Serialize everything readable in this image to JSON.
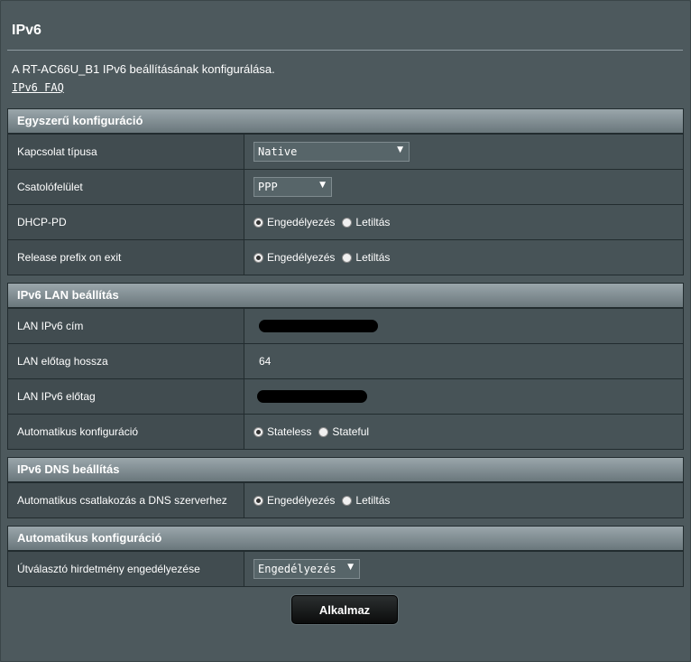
{
  "page": {
    "title": "IPv6",
    "description": "A RT-AC66U_B1 IPv6 beállításának konfigurálása.",
    "faq_link": "IPv6 FAQ"
  },
  "sections": {
    "basic": {
      "header": "Egyszerű konfiguráció",
      "connection_type": {
        "label": "Kapcsolat típusa",
        "value": "Native"
      },
      "interface": {
        "label": "Csatolófelület",
        "value": "PPP"
      },
      "dhcp_pd": {
        "label": "DHCP-PD",
        "opt_on": "Engedélyezés",
        "opt_off": "Letiltás",
        "selected": "Engedélyezés"
      },
      "release_prefix": {
        "label": "Release prefix on exit",
        "opt_on": "Engedélyezés",
        "opt_off": "Letiltás",
        "selected": "Engedélyezés"
      }
    },
    "lan": {
      "header": "IPv6 LAN beállítás",
      "lan_ip": {
        "label": "LAN IPv6 cím"
      },
      "prefix_len": {
        "label": "LAN előtag hossza",
        "value": "64"
      },
      "lan_prefix": {
        "label": "LAN IPv6 előtag"
      },
      "autoconf": {
        "label": "Automatikus konfiguráció",
        "opt_a": "Stateless",
        "opt_b": "Stateful",
        "selected": "Stateless"
      }
    },
    "dns": {
      "header": "IPv6 DNS beállítás",
      "auto_dns": {
        "label": "Automatikus csatlakozás a DNS szerverhez",
        "opt_on": "Engedélyezés",
        "opt_off": "Letiltás",
        "selected": "Engedélyezés"
      }
    },
    "autoconfig": {
      "header": "Automatikus konfiguráció",
      "router_adv": {
        "label": "Útválasztó hirdetmény engedélyezése",
        "value": "Engedélyezés"
      }
    }
  },
  "apply_label": "Alkalmaz",
  "colors": {
    "background": "#4d595d",
    "header_gradient_top": "#9aa6ab",
    "header_gradient_bottom": "#6a777c"
  }
}
